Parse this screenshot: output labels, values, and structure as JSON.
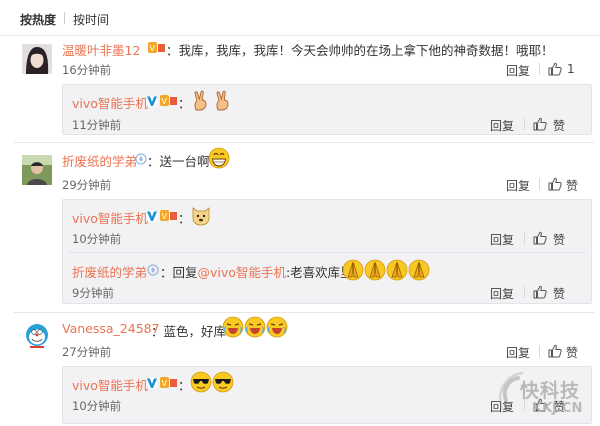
{
  "sort_bar": {
    "hot_label": "按热度",
    "time_label": "按时间"
  },
  "labels": {
    "reply": "回复",
    "like": "赞"
  },
  "comments": [
    {
      "user": "温暖叶非墨12",
      "sep": "：",
      "text": "我库，我库，我库！今天会帅帅的在场上拿下他的神奇数据！哦耶！",
      "time": "16分钟前",
      "likes": "1",
      "replies": [
        {
          "user": "vivo智能手机",
          "sep": "：",
          "text": "",
          "time": "11分钟前"
        }
      ]
    },
    {
      "user": "折废纸的学弟",
      "sep": "：",
      "text": "送一台啊",
      "time": "29分钟前",
      "replies": [
        {
          "user": "vivo智能手机",
          "sep": "：",
          "text": "",
          "time": "10分钟前"
        },
        {
          "user": "折废纸的学弟",
          "sep": "：",
          "text_prefix": "回复",
          "mention": "@vivo智能手机",
          "text": ":老喜欢库里",
          "time": "9分钟前"
        }
      ]
    },
    {
      "user": "Vanessa_24587",
      "sep": "：",
      "text": "蓝色，好库",
      "time": "27分钟前",
      "replies": [
        {
          "user": "vivo智能手机",
          "sep": "：",
          "text": "",
          "time": "10分钟前"
        }
      ]
    }
  ],
  "watermark": {
    "brand": "快科技",
    "domain": "KKJ.CN"
  },
  "colors": {
    "username": "#eb7350",
    "mention": "#eb7350",
    "verified_v": "#1a91d8",
    "reply_bg": "#f2f2f5"
  }
}
